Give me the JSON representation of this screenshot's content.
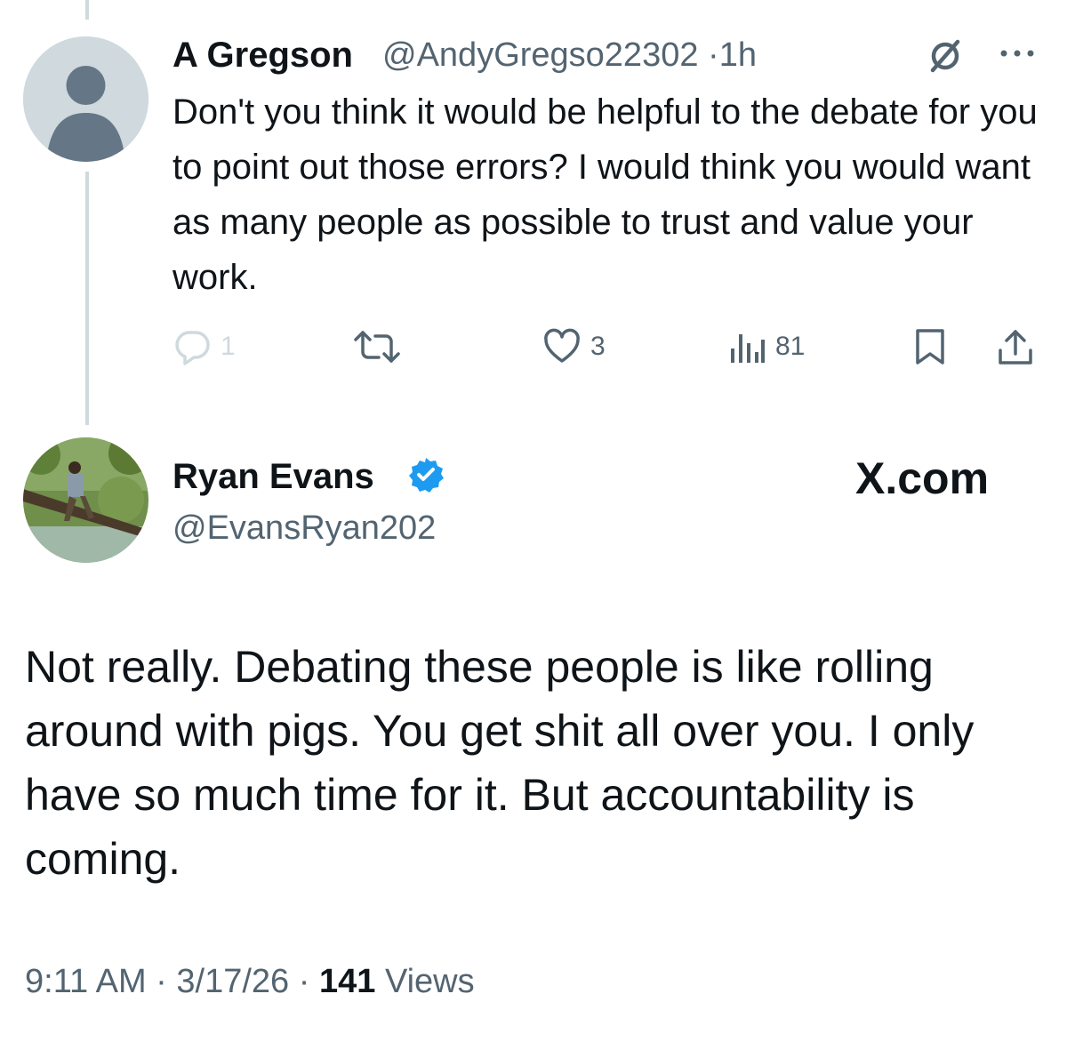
{
  "reply": {
    "author_name": "A Gregson",
    "author_handle": "@AndyGregso22302",
    "separator": "·",
    "time_ago": "1h",
    "text": "Don't you think it would be helpful to the debate for you to point out those errors? I would think you would want as many people as possible to trust and value your work.",
    "actions": {
      "reply_count": "1",
      "like_count": "3",
      "view_count": "81"
    },
    "icons": [
      "grok-icon",
      "more-icon",
      "reply-icon",
      "retweet-icon",
      "like-icon",
      "views-icon",
      "bookmark-icon",
      "share-icon"
    ]
  },
  "main_post": {
    "author_name": "Ryan Evans",
    "author_handle": "@EvansRyan202",
    "verified": true,
    "site_label": "X.com",
    "text": "Not really. Debating these people is like rolling around with pigs. You get shit all over you. I only have so much time for it. But accountability is coming.",
    "time": "9:11 AM",
    "separator": "·",
    "date": "3/17/26",
    "views_count": "141",
    "views_label": "Views"
  },
  "colors": {
    "text": "#0f1419",
    "secondary": "#536471",
    "verified_blue": "#1d9bf0",
    "thread_line": "#cfd9de"
  }
}
